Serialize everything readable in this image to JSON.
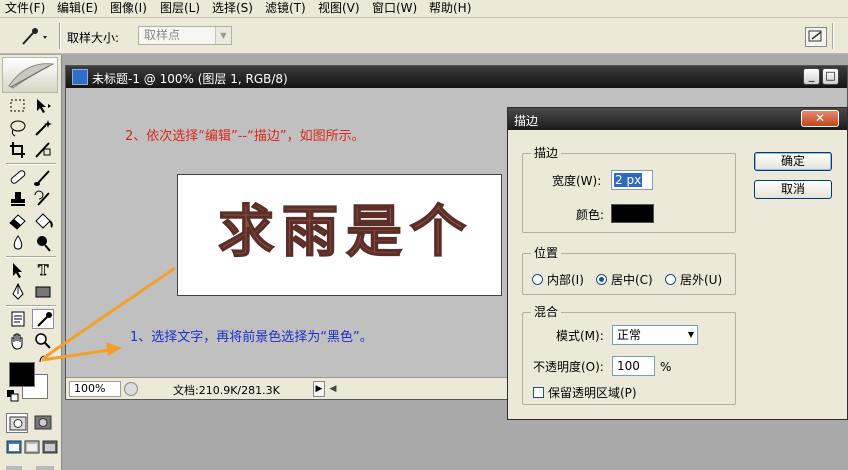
{
  "menu": [
    "文件(F)",
    "编辑(E)",
    "图像(I)",
    "图层(L)",
    "选择(S)",
    "滤镜(T)",
    "视图(V)",
    "窗口(W)",
    "帮助(H)"
  ],
  "options_bar": {
    "sample_size_label": "取样大小:",
    "sample_size_value": "取样点"
  },
  "document": {
    "title": "未标题-1 @ 100% (图层 1, RGB/8)",
    "canvas_text": "求雨是个",
    "zoom": "100%",
    "info": "文档:210.9K/281.3K"
  },
  "dialog": {
    "title": "描边",
    "close": "✕",
    "stroke_group": "描边",
    "width_label": "宽度(W):",
    "width_value": "2 px",
    "color_label": "颜色:",
    "color_value": "#000000",
    "position_group": "位置",
    "positions": [
      "内部(I)",
      "居中(C)",
      "居外(U)"
    ],
    "position_selected": "居中(C)",
    "blend_group": "混合",
    "mode_label": "模式(M):",
    "mode_value": "正常",
    "opacity_label": "不透明度(O):",
    "opacity_value": "100",
    "opacity_unit": "%",
    "preserve_label": "保留透明区域(P)",
    "ok": "确定",
    "cancel": "取消"
  },
  "annotations": {
    "step2": "2、依次选择“编辑”--“描边”，如图所示。",
    "step1": "1、选择文字，再将前景色选择为“黑色”。"
  },
  "colors": {
    "annotation_red": "#d9281b",
    "annotation_blue": "#1d2fcc",
    "arrow_orange": "#f1a02a",
    "stroke_text": "#8a4f47"
  }
}
